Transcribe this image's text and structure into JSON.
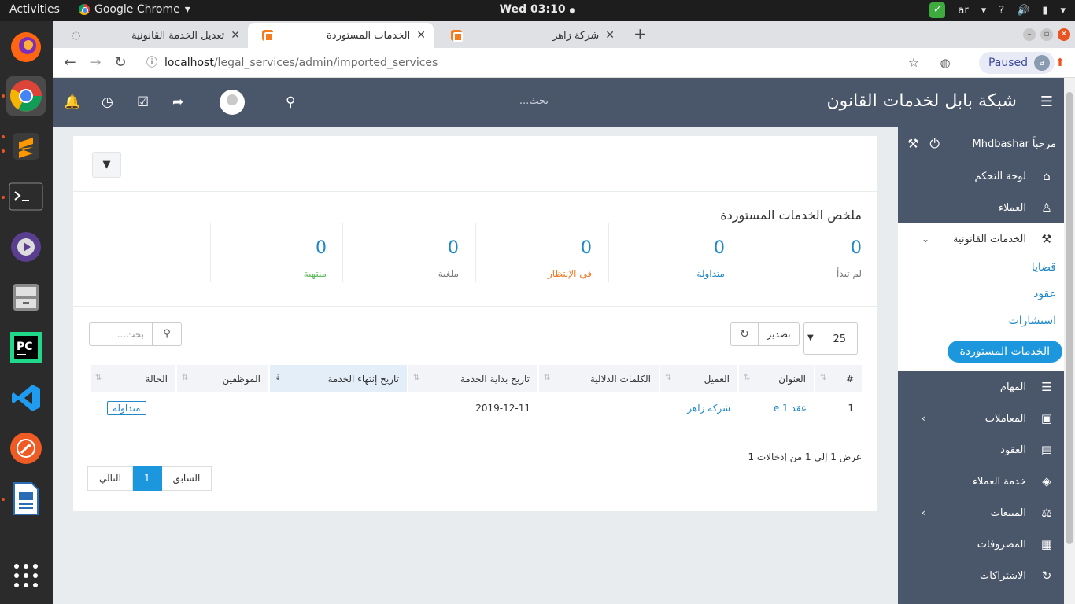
{
  "system": {
    "activities": "Activities",
    "app_name": "Google Chrome",
    "clock": "Wed 03:10",
    "lang": "ar",
    "help": "?"
  },
  "browser": {
    "tabs": [
      {
        "title": "تعديل الخدمة القانونية"
      },
      {
        "title": "الخدمات المستوردة"
      },
      {
        "title": "شركة زاهر"
      }
    ],
    "url_host": "localhost",
    "url_path": "/legal_services/admin/imported_services",
    "paused_label": "Paused",
    "profile_initial": "a"
  },
  "header": {
    "title": "شبكة بابل لخدمات القانون",
    "search_placeholder": "بحث..."
  },
  "sidebar": {
    "welcome": "مرحباً Mhdbashar",
    "items": [
      {
        "label": "لوحة التحكم",
        "icon": "home-icon"
      },
      {
        "label": "العملاء",
        "icon": "user-icon"
      },
      {
        "label": "الخدمات القانونية",
        "icon": "gavel-icon"
      },
      {
        "label": "المهام",
        "icon": "tasks-icon"
      },
      {
        "label": "المعاملات",
        "icon": "briefcase-icon"
      },
      {
        "label": "العقود",
        "icon": "file-icon"
      },
      {
        "label": "خدمة العملاء",
        "icon": "ticket-icon"
      },
      {
        "label": "المبيعات",
        "icon": "balance-icon"
      },
      {
        "label": "المصروفات",
        "icon": "receipt-icon"
      },
      {
        "label": "الاشتراكات",
        "icon": "refresh-icon"
      }
    ],
    "sub_items": [
      {
        "label": "قضايا"
      },
      {
        "label": "عقود"
      },
      {
        "label": "استشارات"
      },
      {
        "label": "الخدمات المستوردة"
      }
    ]
  },
  "summary": {
    "title": "ملخص الخدمات المستوردة",
    "stats": [
      {
        "value": "0",
        "label": "لم تبدأ",
        "color": "#777777"
      },
      {
        "value": "0",
        "label": "متداولة",
        "color": "#1e88c9"
      },
      {
        "value": "0",
        "label": "في الإنتظار",
        "color": "#f07d2a"
      },
      {
        "value": "0",
        "label": "ملغية",
        "color": "#777777"
      },
      {
        "value": "0",
        "label": "منتهية",
        "color": "#5cb85c"
      }
    ]
  },
  "table_controls": {
    "page_size": "25",
    "export_label": "تصدير",
    "search_placeholder": "بحث..."
  },
  "table": {
    "columns": [
      "#",
      "العنوان",
      "العميل",
      "الكلمات الدلالية",
      "تاريخ بداية الخدمة",
      "تاريخ إنتهاء الخدمة",
      "الموظفين",
      "الحالة"
    ],
    "rows": [
      [
        "1",
        "عقد e 1",
        "شركة زاهر",
        "",
        "2019-12-11",
        "",
        "",
        "متداولة"
      ]
    ]
  },
  "footer": {
    "info": "عرض 1 إلى 1 من إدخالات 1",
    "prev": "السابق",
    "current_page": "1",
    "next": "التالي"
  }
}
